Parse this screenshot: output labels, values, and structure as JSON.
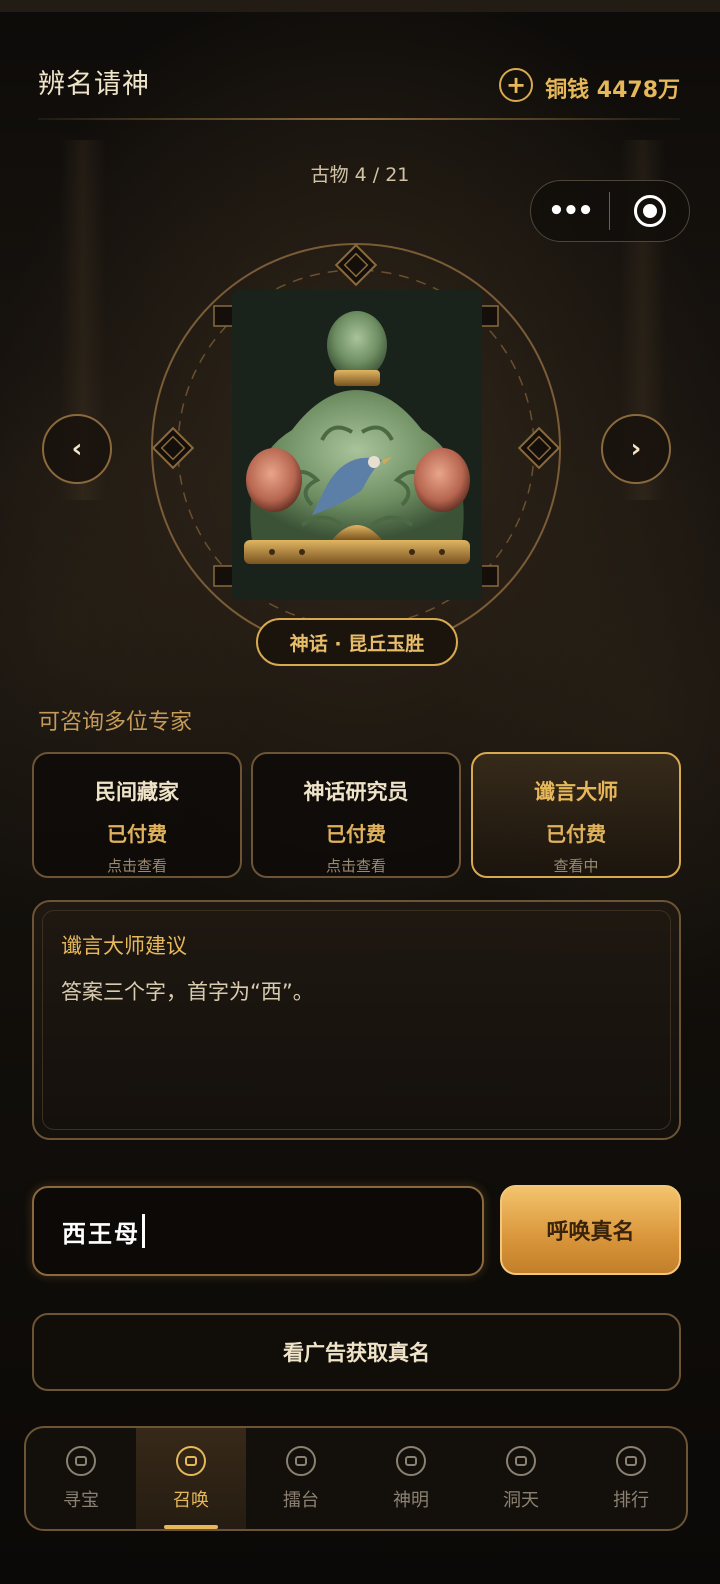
{
  "header": {
    "title": "辨名请神",
    "coin_label": "铜钱 4478万",
    "add_coin_glyph": "+"
  },
  "counter": {
    "label": "古物 4 / 21"
  },
  "capsule": {
    "more_glyph": "•••"
  },
  "nav": {
    "prev_glyph": "‹",
    "next_glyph": "›"
  },
  "relic": {
    "name_badge": "神话 · 昆丘玉胜"
  },
  "experts": {
    "section_label": "可咨询多位专家",
    "items": [
      {
        "name": "民间藏家",
        "status": "已付费",
        "hint": "点击查看"
      },
      {
        "name": "神话研究员",
        "status": "已付费",
        "hint": "点击查看"
      },
      {
        "name": "谶言大师",
        "status": "已付费",
        "hint": "查看中"
      }
    ]
  },
  "advice": {
    "title": "谶言大师建议",
    "text": "答案三个字，首字为“西”。"
  },
  "answer": {
    "value": "西王母"
  },
  "actions": {
    "summon_label": "呼唤真名",
    "ad_label": "看广告获取真名"
  },
  "tabbar": {
    "items": [
      {
        "label": "寻宝",
        "icon": "treasure-icon"
      },
      {
        "label": "召唤",
        "icon": "summon-icon"
      },
      {
        "label": "擂台",
        "icon": "arena-icon"
      },
      {
        "label": "神明",
        "icon": "deity-icon"
      },
      {
        "label": "洞天",
        "icon": "grotto-icon"
      },
      {
        "label": "排行",
        "icon": "ranking-icon"
      }
    ],
    "active": "召唤"
  },
  "colors": {
    "gold": "#e6b85a",
    "dark_bg": "#120f0b",
    "border": "#6d5434"
  }
}
